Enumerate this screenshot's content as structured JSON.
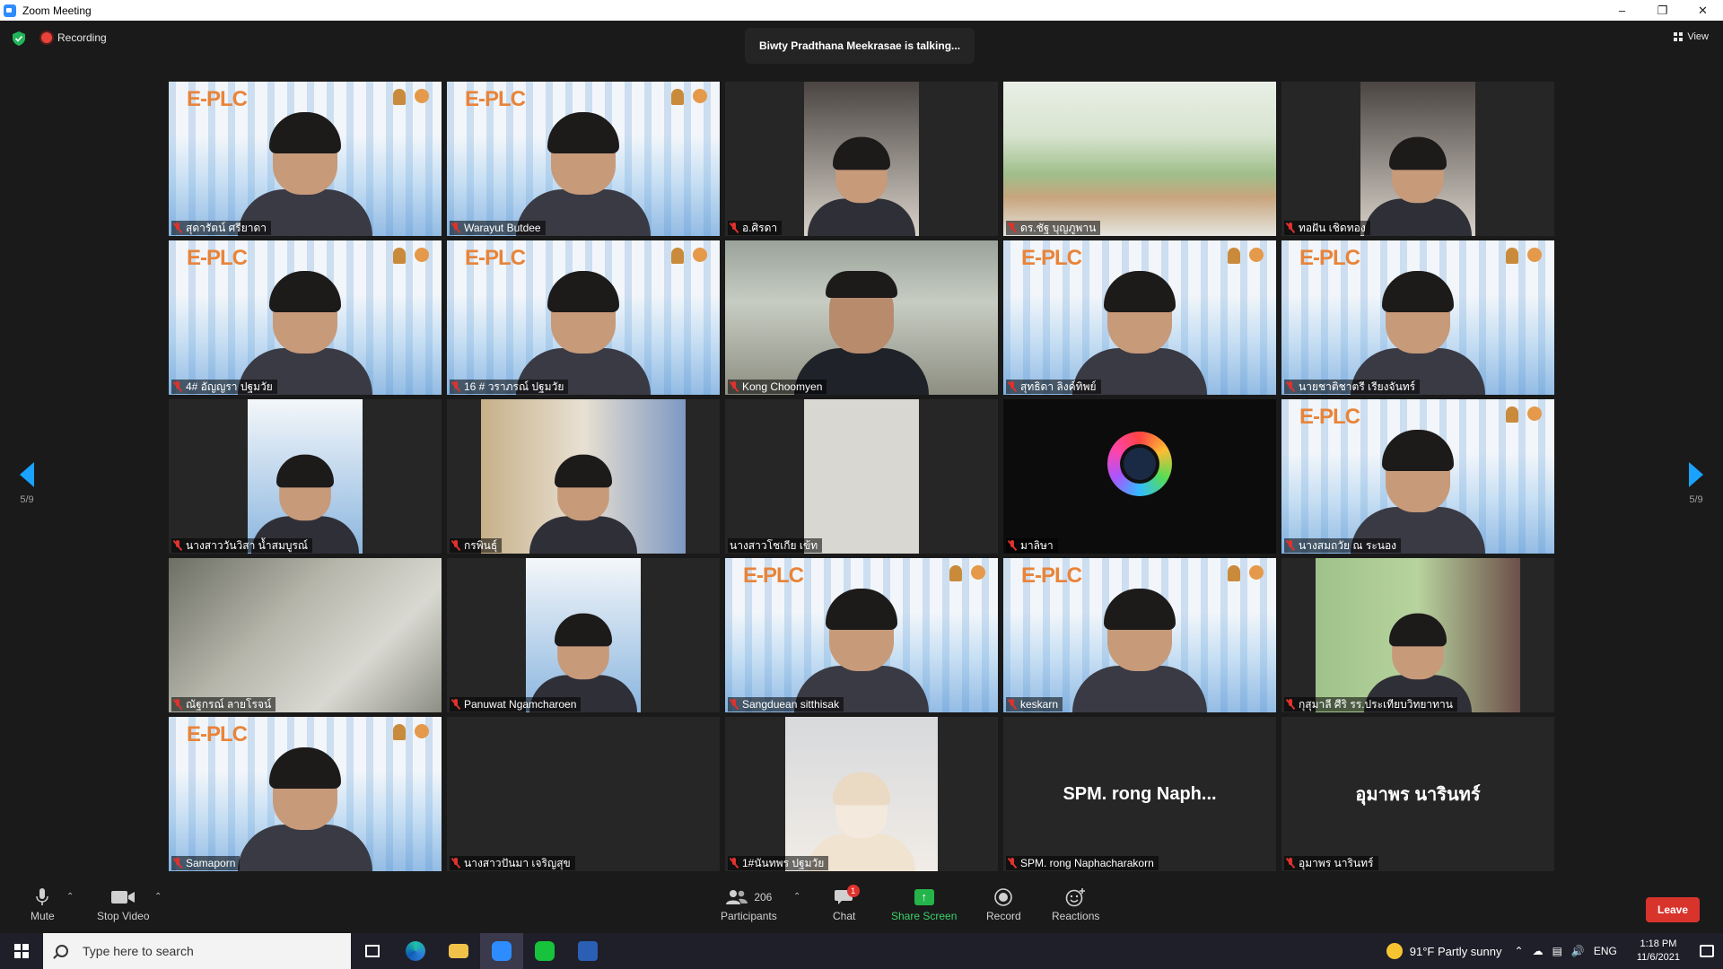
{
  "window": {
    "title": "Zoom Meeting"
  },
  "top": {
    "recording_label": "Recording",
    "talking": "Biwty Pradthana Meekrasae is talking...",
    "view_label": "View"
  },
  "pagination": {
    "left": "5/9",
    "right": "5/9"
  },
  "participants": [
    {
      "name": "สุดารัตน์ ศรียาดา",
      "bg": "eplc"
    },
    {
      "name": "Warayut Butdee",
      "bg": "eplc"
    },
    {
      "name": "อ.ศิรดา",
      "bg": "narrow-car"
    },
    {
      "name": "ดร.ชัฐ บุญภูพาน",
      "bg": "building"
    },
    {
      "name": "ทอฝัน เชิดทอง",
      "bg": "narrow-car"
    },
    {
      "name": "4# อัญญรา ปฐมวัย",
      "bg": "eplc"
    },
    {
      "name": "16 # วราภรณ์ ปฐมวัย",
      "bg": "eplc"
    },
    {
      "name": "Kong Choomyen",
      "bg": "room"
    },
    {
      "name": "สุทธิดา ลิงค์ทิพย์",
      "bg": "eplc"
    },
    {
      "name": "นายชาติชาตรี เรียงจันทร์",
      "bg": "eplc"
    },
    {
      "name": "นางสาววันวิสา น้ำสมบูรณ์",
      "bg": "narrow-eplc"
    },
    {
      "name": "กรพินธุ์",
      "bg": "narrow-blur"
    },
    {
      "name": "นางสาวโชเกีย เข้ท",
      "bg": "narrow-wall"
    },
    {
      "name": "มาลิษา",
      "bg": "camera"
    },
    {
      "name": "นางสมถวัย ณ ระนอง",
      "bg": "eplc"
    },
    {
      "name": "ณัฐกรณ์ ลายโรจน์",
      "bg": "ceiling"
    },
    {
      "name": "Panuwat Ngamcharoen",
      "bg": "narrow-eplc"
    },
    {
      "name": "Sangduean sitthisak",
      "bg": "eplc"
    },
    {
      "name": "keskarn",
      "bg": "eplc"
    },
    {
      "name": "กุสุมาลี ศีริ รร.ประเทียบวิทยาทาน",
      "bg": "narrow-green"
    },
    {
      "name": "Samaporn",
      "bg": "eplc"
    },
    {
      "name": "นางสาวปันมา เจริญสุข",
      "bg": "dark"
    },
    {
      "name": "1#นันทพร ปฐมวัย",
      "bg": "narrow-dog"
    },
    {
      "name": "SPM. rong Naphacharakorn",
      "bg": "text",
      "display": "SPM. rong Naph..."
    },
    {
      "name": "อุมาพร นารินทร์",
      "bg": "text",
      "display": "อุมาพร นารินทร์"
    }
  ],
  "toolbar": {
    "mute": "Mute",
    "stop_video": "Stop Video",
    "participants_label": "Participants",
    "participants_count": "206",
    "chat": "Chat",
    "chat_badge": "1",
    "share": "Share Screen",
    "record": "Record",
    "reactions": "Reactions",
    "leave": "Leave"
  },
  "taskbar": {
    "search_placeholder": "Type here to search",
    "weather": "91°F  Partly sunny",
    "lang": "ENG",
    "time": "1:18 PM",
    "date": "11/6/2021"
  }
}
